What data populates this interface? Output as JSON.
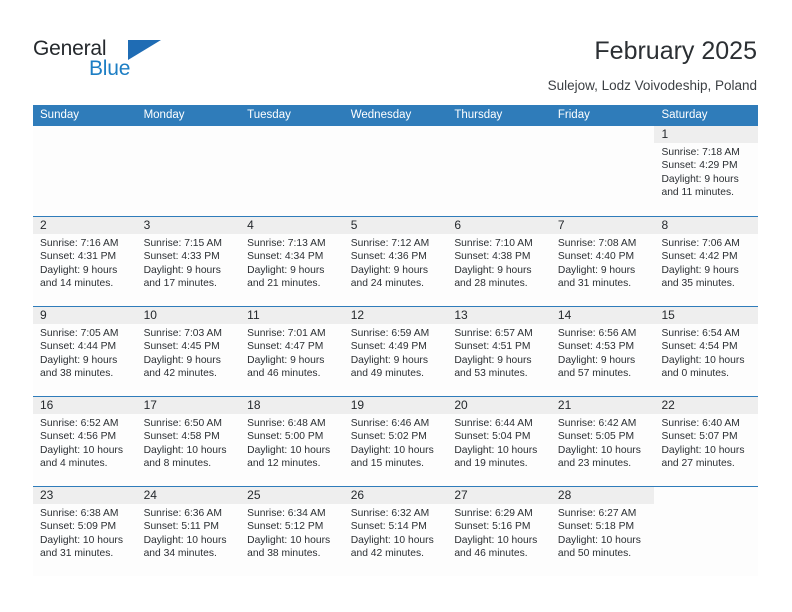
{
  "brand": {
    "name_part1": "General",
    "name_part2": "Blue",
    "logo_icon": "triangle-logo-icon"
  },
  "header": {
    "title": "February 2025",
    "location": "Sulejow, Lodz Voivodeship, Poland"
  },
  "colors": {
    "header_blue": "#2f7cba",
    "brand_blue": "#1d7ec4",
    "daynum_band": "#eeeeee",
    "text": "#25292d"
  },
  "calendar": {
    "weekday_headers": [
      "Sunday",
      "Monday",
      "Tuesday",
      "Wednesday",
      "Thursday",
      "Friday",
      "Saturday"
    ],
    "weeks": [
      [
        {
          "blank": true
        },
        {
          "blank": true
        },
        {
          "blank": true
        },
        {
          "blank": true
        },
        {
          "blank": true
        },
        {
          "blank": true
        },
        {
          "day": "1",
          "sunrise": "Sunrise: 7:18 AM",
          "sunset": "Sunset: 4:29 PM",
          "daylight1": "Daylight: 9 hours",
          "daylight2": "and 11 minutes."
        }
      ],
      [
        {
          "day": "2",
          "sunrise": "Sunrise: 7:16 AM",
          "sunset": "Sunset: 4:31 PM",
          "daylight1": "Daylight: 9 hours",
          "daylight2": "and 14 minutes."
        },
        {
          "day": "3",
          "sunrise": "Sunrise: 7:15 AM",
          "sunset": "Sunset: 4:33 PM",
          "daylight1": "Daylight: 9 hours",
          "daylight2": "and 17 minutes."
        },
        {
          "day": "4",
          "sunrise": "Sunrise: 7:13 AM",
          "sunset": "Sunset: 4:34 PM",
          "daylight1": "Daylight: 9 hours",
          "daylight2": "and 21 minutes."
        },
        {
          "day": "5",
          "sunrise": "Sunrise: 7:12 AM",
          "sunset": "Sunset: 4:36 PM",
          "daylight1": "Daylight: 9 hours",
          "daylight2": "and 24 minutes."
        },
        {
          "day": "6",
          "sunrise": "Sunrise: 7:10 AM",
          "sunset": "Sunset: 4:38 PM",
          "daylight1": "Daylight: 9 hours",
          "daylight2": "and 28 minutes."
        },
        {
          "day": "7",
          "sunrise": "Sunrise: 7:08 AM",
          "sunset": "Sunset: 4:40 PM",
          "daylight1": "Daylight: 9 hours",
          "daylight2": "and 31 minutes."
        },
        {
          "day": "8",
          "sunrise": "Sunrise: 7:06 AM",
          "sunset": "Sunset: 4:42 PM",
          "daylight1": "Daylight: 9 hours",
          "daylight2": "and 35 minutes."
        }
      ],
      [
        {
          "day": "9",
          "sunrise": "Sunrise: 7:05 AM",
          "sunset": "Sunset: 4:44 PM",
          "daylight1": "Daylight: 9 hours",
          "daylight2": "and 38 minutes."
        },
        {
          "day": "10",
          "sunrise": "Sunrise: 7:03 AM",
          "sunset": "Sunset: 4:45 PM",
          "daylight1": "Daylight: 9 hours",
          "daylight2": "and 42 minutes."
        },
        {
          "day": "11",
          "sunrise": "Sunrise: 7:01 AM",
          "sunset": "Sunset: 4:47 PM",
          "daylight1": "Daylight: 9 hours",
          "daylight2": "and 46 minutes."
        },
        {
          "day": "12",
          "sunrise": "Sunrise: 6:59 AM",
          "sunset": "Sunset: 4:49 PM",
          "daylight1": "Daylight: 9 hours",
          "daylight2": "and 49 minutes."
        },
        {
          "day": "13",
          "sunrise": "Sunrise: 6:57 AM",
          "sunset": "Sunset: 4:51 PM",
          "daylight1": "Daylight: 9 hours",
          "daylight2": "and 53 minutes."
        },
        {
          "day": "14",
          "sunrise": "Sunrise: 6:56 AM",
          "sunset": "Sunset: 4:53 PM",
          "daylight1": "Daylight: 9 hours",
          "daylight2": "and 57 minutes."
        },
        {
          "day": "15",
          "sunrise": "Sunrise: 6:54 AM",
          "sunset": "Sunset: 4:54 PM",
          "daylight1": "Daylight: 10 hours",
          "daylight2": "and 0 minutes."
        }
      ],
      [
        {
          "day": "16",
          "sunrise": "Sunrise: 6:52 AM",
          "sunset": "Sunset: 4:56 PM",
          "daylight1": "Daylight: 10 hours",
          "daylight2": "and 4 minutes."
        },
        {
          "day": "17",
          "sunrise": "Sunrise: 6:50 AM",
          "sunset": "Sunset: 4:58 PM",
          "daylight1": "Daylight: 10 hours",
          "daylight2": "and 8 minutes."
        },
        {
          "day": "18",
          "sunrise": "Sunrise: 6:48 AM",
          "sunset": "Sunset: 5:00 PM",
          "daylight1": "Daylight: 10 hours",
          "daylight2": "and 12 minutes."
        },
        {
          "day": "19",
          "sunrise": "Sunrise: 6:46 AM",
          "sunset": "Sunset: 5:02 PM",
          "daylight1": "Daylight: 10 hours",
          "daylight2": "and 15 minutes."
        },
        {
          "day": "20",
          "sunrise": "Sunrise: 6:44 AM",
          "sunset": "Sunset: 5:04 PM",
          "daylight1": "Daylight: 10 hours",
          "daylight2": "and 19 minutes."
        },
        {
          "day": "21",
          "sunrise": "Sunrise: 6:42 AM",
          "sunset": "Sunset: 5:05 PM",
          "daylight1": "Daylight: 10 hours",
          "daylight2": "and 23 minutes."
        },
        {
          "day": "22",
          "sunrise": "Sunrise: 6:40 AM",
          "sunset": "Sunset: 5:07 PM",
          "daylight1": "Daylight: 10 hours",
          "daylight2": "and 27 minutes."
        }
      ],
      [
        {
          "day": "23",
          "sunrise": "Sunrise: 6:38 AM",
          "sunset": "Sunset: 5:09 PM",
          "daylight1": "Daylight: 10 hours",
          "daylight2": "and 31 minutes."
        },
        {
          "day": "24",
          "sunrise": "Sunrise: 6:36 AM",
          "sunset": "Sunset: 5:11 PM",
          "daylight1": "Daylight: 10 hours",
          "daylight2": "and 34 minutes."
        },
        {
          "day": "25",
          "sunrise": "Sunrise: 6:34 AM",
          "sunset": "Sunset: 5:12 PM",
          "daylight1": "Daylight: 10 hours",
          "daylight2": "and 38 minutes."
        },
        {
          "day": "26",
          "sunrise": "Sunrise: 6:32 AM",
          "sunset": "Sunset: 5:14 PM",
          "daylight1": "Daylight: 10 hours",
          "daylight2": "and 42 minutes."
        },
        {
          "day": "27",
          "sunrise": "Sunrise: 6:29 AM",
          "sunset": "Sunset: 5:16 PM",
          "daylight1": "Daylight: 10 hours",
          "daylight2": "and 46 minutes."
        },
        {
          "day": "28",
          "sunrise": "Sunrise: 6:27 AM",
          "sunset": "Sunset: 5:18 PM",
          "daylight1": "Daylight: 10 hours",
          "daylight2": "and 50 minutes."
        },
        {
          "blank": true
        }
      ]
    ]
  }
}
